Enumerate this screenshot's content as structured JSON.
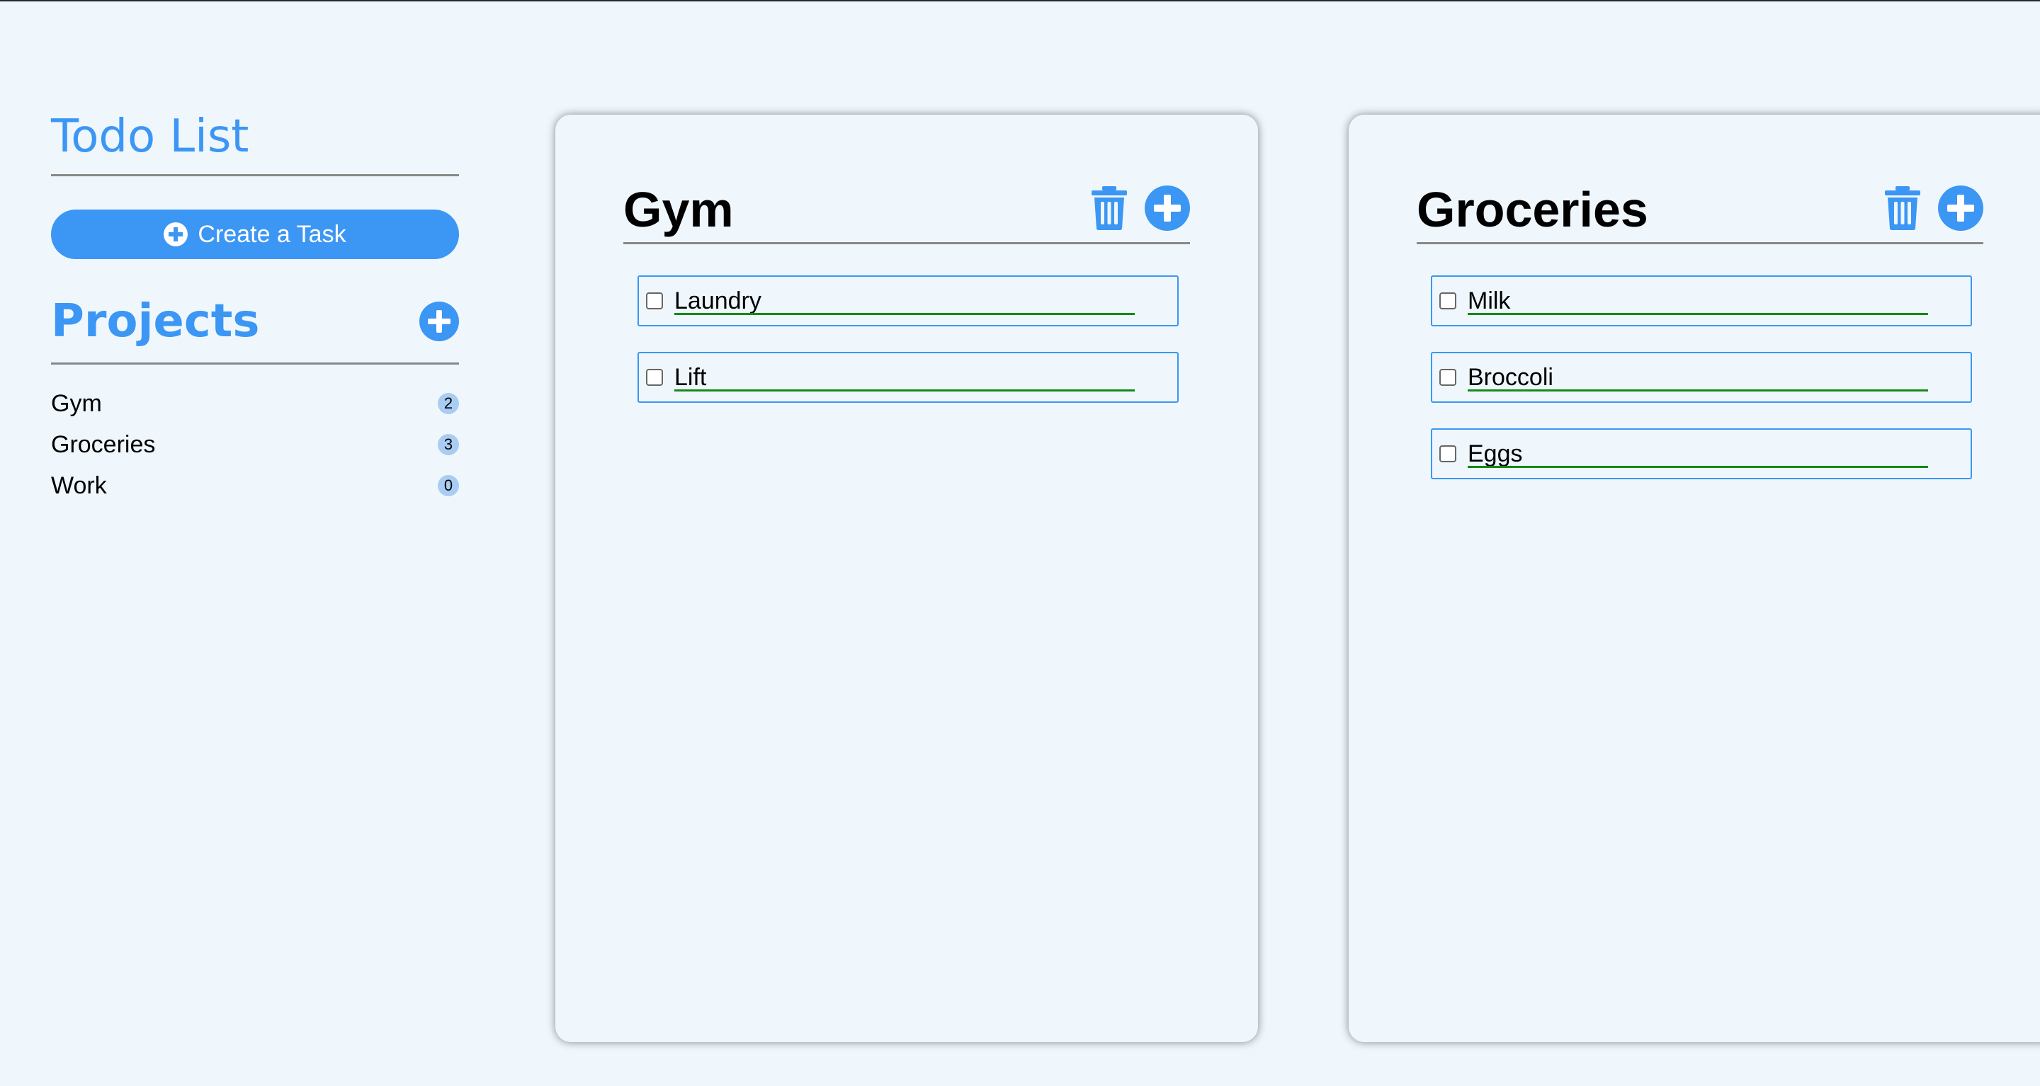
{
  "sidebar": {
    "app_title": "Todo List",
    "create_task_label": "Create a Task",
    "projects_title": "Projects",
    "projects": [
      {
        "name": "Gym",
        "count": "2"
      },
      {
        "name": "Groceries",
        "count": "3"
      },
      {
        "name": "Work",
        "count": "0"
      }
    ]
  },
  "cards": [
    {
      "title": "Gym",
      "tasks": [
        "Laundry",
        "Lift"
      ]
    },
    {
      "title": "Groceries",
      "tasks": [
        "Milk",
        "Broccoli",
        "Eggs"
      ]
    }
  ],
  "colors": {
    "accent": "#3c96f4",
    "background": "#eff7fd",
    "badge": "#a9ccf3",
    "task_underline": "#138a1a"
  },
  "icons": {
    "add": "plus-circle-icon",
    "delete": "trash-icon"
  }
}
